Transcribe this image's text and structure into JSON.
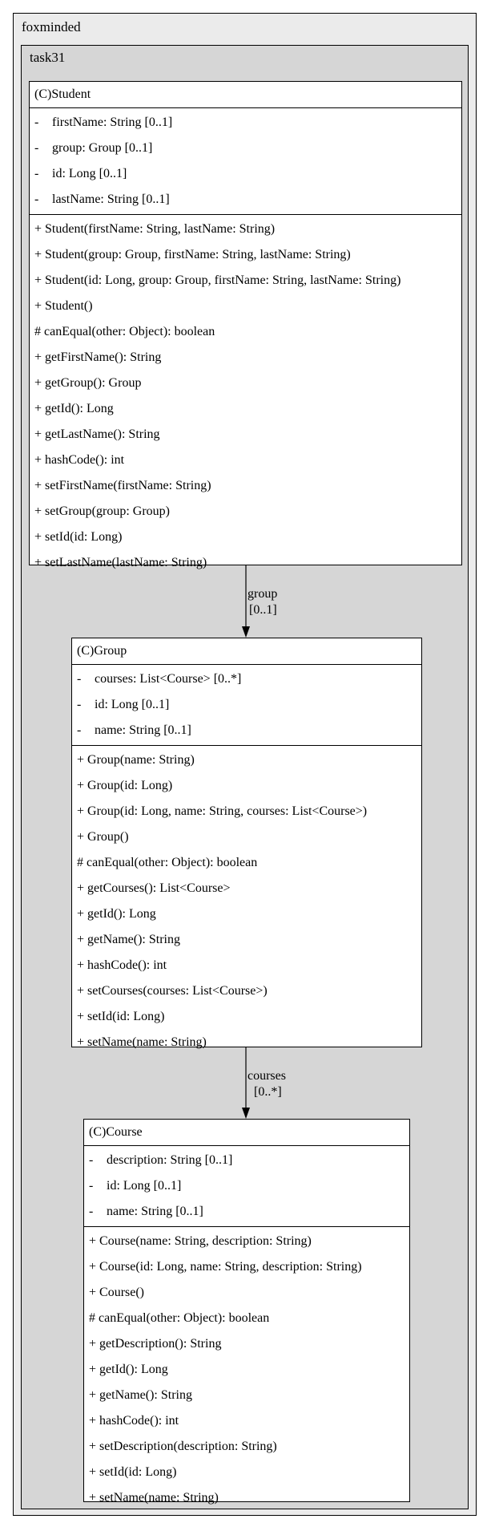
{
  "packages": {
    "outer": "foxminded",
    "inner": "task31"
  },
  "classes": {
    "student": {
      "name": "(C)Student",
      "attributes": [
        {
          "vis": "-",
          "text": "firstName: String [0..1]"
        },
        {
          "vis": "-",
          "text": "group: Group [0..1]"
        },
        {
          "vis": "-",
          "text": "id: Long [0..1]"
        },
        {
          "vis": "-",
          "text": "lastName: String [0..1]"
        }
      ],
      "operations": [
        "+ Student(firstName: String, lastName: String)",
        "+ Student(group: Group, firstName: String, lastName: String)",
        "+ Student(id: Long, group: Group, firstName: String, lastName: String)",
        "+ Student()",
        "# canEqual(other: Object): boolean",
        "+ getFirstName(): String",
        "+ getGroup(): Group",
        "+ getId(): Long",
        "+ getLastName(): String",
        "+ hashCode(): int",
        "+ setFirstName(firstName: String)",
        "+ setGroup(group: Group)",
        "+ setId(id: Long)",
        "+ setLastName(lastName: String)"
      ]
    },
    "group": {
      "name": "(C)Group",
      "attributes": [
        {
          "vis": "-",
          "text": "courses: List<Course> [0..*]"
        },
        {
          "vis": "-",
          "text": "id: Long [0..1]"
        },
        {
          "vis": "-",
          "text": "name: String [0..1]"
        }
      ],
      "operations": [
        "+ Group(name: String)",
        "+ Group(id: Long)",
        "+ Group(id: Long, name: String, courses: List<Course>)",
        "+ Group()",
        "# canEqual(other: Object): boolean",
        "+ getCourses(): List<Course>",
        "+ getId(): Long",
        "+ getName(): String",
        "+ hashCode(): int",
        "+ setCourses(courses: List<Course>)",
        "+ setId(id: Long)",
        "+ setName(name: String)"
      ]
    },
    "course": {
      "name": "(C)Course",
      "attributes": [
        {
          "vis": "-",
          "text": "description: String [0..1]"
        },
        {
          "vis": "-",
          "text": "id: Long [0..1]"
        },
        {
          "vis": "-",
          "text": "name: String [0..1]"
        }
      ],
      "operations": [
        "+ Course(name: String, description: String)",
        "+ Course(id: Long, name: String, description: String)",
        "+ Course()",
        "# canEqual(other: Object): boolean",
        "+ getDescription(): String",
        "+ getId(): Long",
        "+ getName(): String",
        "+ hashCode(): int",
        "+ setDescription(description: String)",
        "+ setId(id: Long)",
        "+ setName(name: String)"
      ]
    }
  },
  "associations": [
    {
      "label": "group",
      "multiplicity": "[0..1]"
    },
    {
      "label": "courses",
      "multiplicity": "[0..*]"
    }
  ]
}
